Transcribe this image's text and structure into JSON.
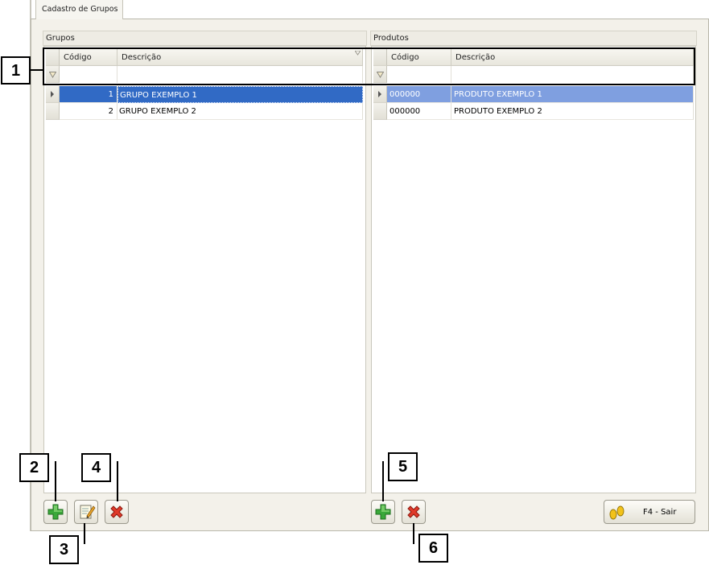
{
  "tab": {
    "label": "Cadastro de Grupos"
  },
  "groups_panel": {
    "title": "Grupos",
    "columns": [
      "Código",
      "Descrição"
    ],
    "rows": [
      {
        "codigo": "1",
        "descricao": "GRUPO EXEMPLO 1",
        "selected": true
      },
      {
        "codigo": "2",
        "descricao": "GRUPO EXEMPLO 2",
        "selected": false
      }
    ]
  },
  "products_panel": {
    "title": "Produtos",
    "columns": [
      "Código",
      "Descrição"
    ],
    "rows": [
      {
        "codigo": "000000",
        "descricao": "PRODUTO EXEMPLO 1",
        "selected": true
      },
      {
        "codigo": "000000",
        "descricao": "PRODUTO EXEMPLO 2",
        "selected": false
      }
    ]
  },
  "buttons": {
    "groups_add": "plus-icon",
    "groups_edit": "edit-icon",
    "groups_delete": "delete-icon",
    "products_add": "plus-icon",
    "products_delete": "delete-icon",
    "exit_label": "F4 - Sair"
  },
  "callouts": {
    "c1": "1",
    "c2": "2",
    "c3": "3",
    "c4": "4",
    "c5": "5",
    "c6": "6"
  },
  "colors": {
    "selection_dark": "#316ac5",
    "selection_light": "#7f9fe0",
    "add_green": "#3aa83a",
    "delete_red": "#e03a2a"
  }
}
